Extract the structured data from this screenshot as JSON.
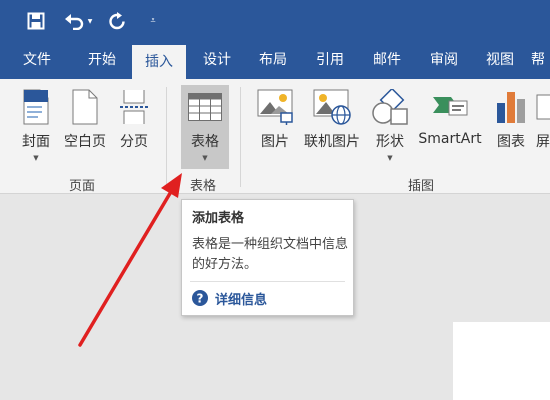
{
  "quick_access": {
    "icons": [
      "save-icon",
      "undo-icon",
      "redo-icon",
      "customize-icon"
    ],
    "customize_glyph": "⩡"
  },
  "tabs": [
    "文件",
    "开始",
    "插入",
    "设计",
    "布局",
    "引用",
    "邮件",
    "审阅",
    "视图",
    "帮"
  ],
  "active_tab": "插入",
  "ribbon": {
    "pages_group": {
      "label": "页面",
      "buttons": [
        "封面",
        "空白页",
        "分页"
      ]
    },
    "tables_group": {
      "label": "表格",
      "buttons": [
        "表格"
      ]
    },
    "illustrations_group": {
      "label": "插图",
      "buttons": [
        "图片",
        "联机图片",
        "形状",
        "SmartArt",
        "图表",
        "屏"
      ]
    },
    "caret_glyph": "▼"
  },
  "tooltip": {
    "title": "添加表格",
    "body": "表格是一种组织文档中信息的好方法。",
    "link": "详细信息"
  },
  "colors": {
    "title_bar": "#2b579a",
    "ribbon": "#f3f3f3",
    "arrow": "#e02020"
  }
}
